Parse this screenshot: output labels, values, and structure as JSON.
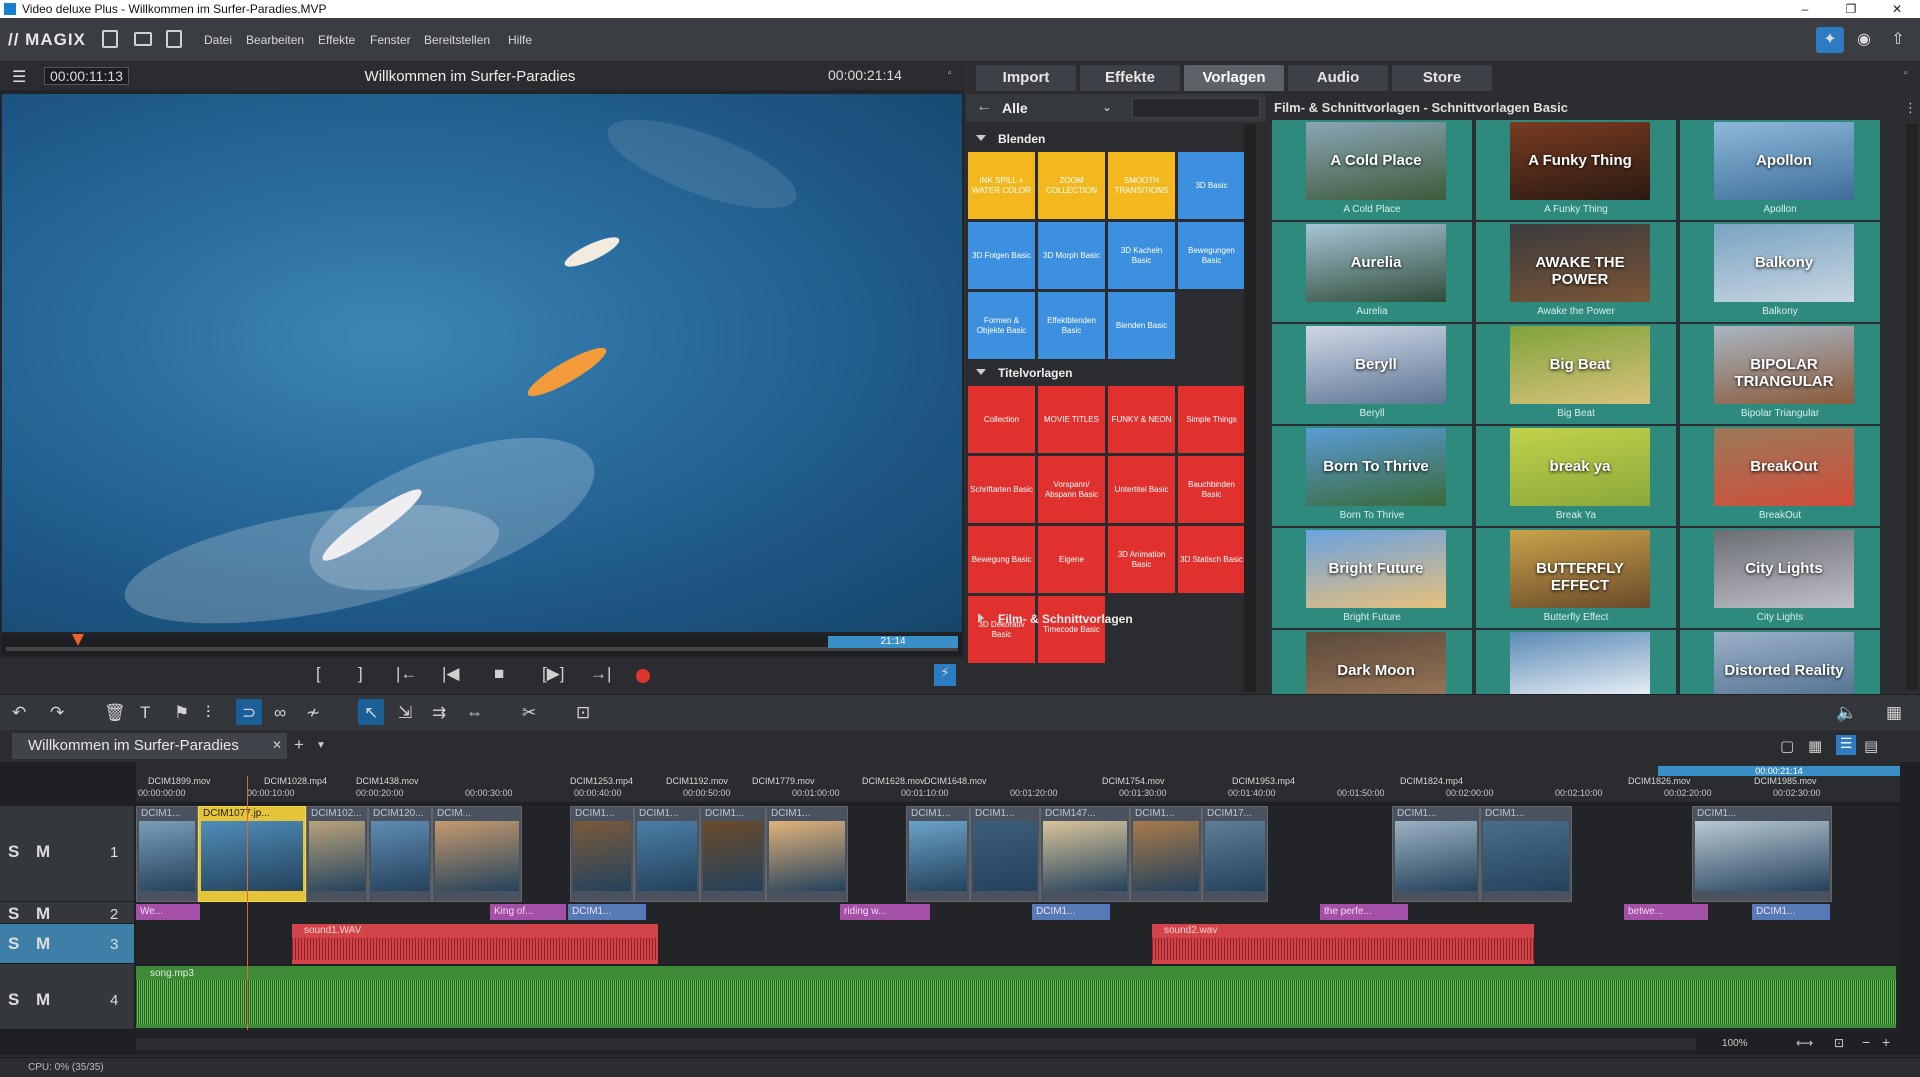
{
  "window": {
    "title": "Video deluxe Plus - Willkommen im Surfer-Paradies.MVP",
    "controls": [
      "–",
      "❐",
      "✕"
    ]
  },
  "menubar": {
    "brand": "// MAGIX",
    "items": [
      "Datei",
      "Bearbeiten",
      "Effekte",
      "Fenster",
      "Bereitstellen",
      "Hilfe"
    ]
  },
  "preview": {
    "timecode_left": "00:00:11:13",
    "title": "Willkommen im Surfer-Paradies",
    "timecode_right": "00:00:21:14",
    "duration_label": "21:14"
  },
  "transport": {
    "buttons": [
      "[",
      "]",
      "|←",
      "|◀",
      "■",
      "[▶]",
      "→|"
    ]
  },
  "tabs": [
    {
      "label": "Import",
      "active": false
    },
    {
      "label": "Effekte",
      "active": false
    },
    {
      "label": "Vorlagen",
      "active": true
    },
    {
      "label": "Audio",
      "active": false
    },
    {
      "label": "Store",
      "active": false
    }
  ],
  "filter": {
    "label": "Alle"
  },
  "categories": {
    "blenden": {
      "label": "Blenden",
      "tiles": [
        {
          "label": "INK SPILL + WATER COLOR",
          "color": "y"
        },
        {
          "label": "ZOOM COLLECTION",
          "color": "y"
        },
        {
          "label": "SMOOTH TRANSITIONS",
          "color": "y"
        },
        {
          "label": "3D Basic",
          "color": "b"
        },
        {
          "label": "3D Folgen Basic",
          "color": "b"
        },
        {
          "label": "3D Morph Basic",
          "color": "b"
        },
        {
          "label": "3D Kacheln Basic",
          "color": "b"
        },
        {
          "label": "Bewegungen Basic",
          "color": "b"
        },
        {
          "label": "Formen & Objekte Basic",
          "color": "b"
        },
        {
          "label": "Effektblenden Basic",
          "color": "b"
        },
        {
          "label": "Blenden Basic",
          "color": "b"
        }
      ]
    },
    "titel": {
      "label": "Titelvorlagen",
      "tiles": [
        {
          "label": "Collection",
          "color": "r"
        },
        {
          "label": "MOVIE TITLES",
          "color": "r"
        },
        {
          "label": "FUNKY & NEON",
          "color": "r"
        },
        {
          "label": "Simple Things",
          "color": "r"
        },
        {
          "label": "Schriftarten Basic",
          "color": "r"
        },
        {
          "label": "Vorspann/ Abspann Basic",
          "color": "r"
        },
        {
          "label": "Untertitel Basic",
          "color": "r"
        },
        {
          "label": "Bauchbinden Basic",
          "color": "r"
        },
        {
          "label": "Bewegung Basic",
          "color": "r"
        },
        {
          "label": "Eigene",
          "color": "r"
        },
        {
          "label": "3D Animation Basic",
          "color": "r"
        },
        {
          "label": "3D Statisch Basic",
          "color": "r"
        },
        {
          "label": "3D Dekorativ Basic",
          "color": "r"
        },
        {
          "label": "Timecode Basic",
          "color": "r"
        }
      ]
    },
    "film": {
      "label": "Film- & Schnittvorlagen"
    }
  },
  "templates": {
    "header": "Film- & Schnittvorlagen - Schnittvorlagen Basic",
    "items": [
      {
        "overlay": "A Cold Place",
        "caption": "A Cold Place"
      },
      {
        "overlay": "A Funky Thing",
        "caption": "A Funky Thing"
      },
      {
        "overlay": "Apollon",
        "caption": "Apollon"
      },
      {
        "overlay": "Aurelia",
        "caption": "Aurelia"
      },
      {
        "overlay": "AWAKE THE POWER",
        "caption": "Awake the Power"
      },
      {
        "overlay": "Balkony",
        "caption": "Balkony"
      },
      {
        "overlay": "Beryll",
        "caption": "Beryll"
      },
      {
        "overlay": "Big Beat",
        "caption": "Big Beat"
      },
      {
        "overlay": "BIPOLAR TRIANGULAR",
        "caption": "Bipolar Triangular"
      },
      {
        "overlay": "Born To Thrive",
        "caption": "Born To Thrive"
      },
      {
        "overlay": "break ya",
        "caption": "Break Ya"
      },
      {
        "overlay": "BreakOut",
        "caption": "BreakOut"
      },
      {
        "overlay": "Bright Future",
        "caption": "Bright Future"
      },
      {
        "overlay": "BUTTERFLY EFFECT",
        "caption": "Butterfly Effect"
      },
      {
        "overlay": "City Lights",
        "caption": "City Lights"
      },
      {
        "overlay": "Dark Moon",
        "caption": "Dark Moon"
      },
      {
        "overlay": "",
        "caption": ""
      },
      {
        "overlay": "Distorted Reality",
        "caption": ""
      }
    ]
  },
  "project": {
    "tab_label": "Willkommen im Surfer-Paradies"
  },
  "timeline": {
    "ticks": [
      "00:00:00:00",
      "00:00:10:00",
      "00:00:20:00",
      "00:00:30:00",
      "00:00:40:00",
      "00:00:50:00",
      "00:01:00:00",
      "00:01:10:00",
      "00:01:20:00",
      "00:01:30:00",
      "00:01:40:00",
      "00:01:50:00",
      "00:02:00:00",
      "00:02:10:00",
      "00:02:20:00",
      "00:02:30:00"
    ],
    "ruler_clips": [
      "DCIM1899.mov",
      "DCIM1028.mp4",
      "DCIM1438.mov",
      "DCIM1253.mp4",
      "DCIM1192.mov",
      "DCIM1779.mov",
      "DCIM1628.mov",
      "DCIM1648.mov",
      "DCIM1754.mov",
      "DCIM1953.mp4",
      "DCIM1824.mp4",
      "DCIM1826.mov",
      "DCIM1985.mov"
    ],
    "ruler_duration": "00:00:21:14",
    "tracks": [
      "1",
      "2",
      "3",
      "4"
    ],
    "smc_label": "S M",
    "video_clips": [
      "DCIM1...",
      "DCIM1077.jp...",
      "DCIM102...",
      "DCIM120...",
      "DCIM...",
      "DCIM1...",
      "DCIM1...",
      "DCIM1...",
      "DCIM1...",
      "DCIM1...",
      "DCIM1...",
      "DCIM147...",
      "DCIM1...",
      "DCIM17...",
      "DCIM1...",
      "DCIM1...",
      "DCIM1..."
    ],
    "title_clips": [
      "We...",
      "King of...",
      "DCIM1...",
      "riding w...",
      "DCIM1...",
      "the perfe...",
      "betwe...",
      "DCIM1..."
    ],
    "audio_clips": [
      "sound1.WAV",
      "sound2.wav"
    ],
    "music_clip": "song.mp3",
    "zoom": "100%"
  },
  "status": {
    "cpu": "CPU: 0% (35/35)"
  }
}
